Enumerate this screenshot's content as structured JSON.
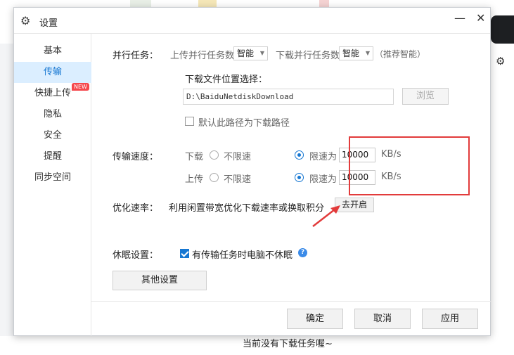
{
  "background": {
    "empty_message": "当前没有下载任务喔~"
  },
  "dialog": {
    "title": "设置",
    "title_icon": "gear-icon",
    "minimize_glyph": "—",
    "close_glyph": "✕"
  },
  "sidebar": {
    "items": [
      {
        "label": "基本"
      },
      {
        "label": "传输"
      },
      {
        "label": "快捷上传"
      },
      {
        "label": "隐私"
      },
      {
        "label": "安全"
      },
      {
        "label": "提醒"
      },
      {
        "label": "同步空间"
      }
    ],
    "active_index": 1,
    "new_badge": "NEW"
  },
  "parallel": {
    "section_label": "并行任务：",
    "upload_label": "上传并行任务数",
    "upload_value": "智能",
    "download_label": "下载并行任务数",
    "download_value": "智能",
    "hint": "（推荐智能）"
  },
  "download_location": {
    "label": "下载文件位置选择：",
    "path": "D:\\BaiduNetdiskDownload",
    "browse_button": "浏览",
    "default_checkbox_label": "默认此路径为下载路径",
    "default_checked": false
  },
  "speed": {
    "section_label": "传输速度：",
    "download_label": "下载",
    "upload_label": "上传",
    "unlimited_label": "不限速",
    "limit_label": "限速为",
    "download_limit": "10000",
    "upload_limit": "10000",
    "unit": "KB/s"
  },
  "optimize": {
    "section_label": "优化速率：",
    "description": "利用闲置带宽优化下载速率或换取积分",
    "button": "去开启"
  },
  "sleep": {
    "section_label": "休眠设置：",
    "checkbox_label": "有传输任务时电脑不休眠",
    "checked": true,
    "help_glyph": "?"
  },
  "other_button": "其他设置",
  "footer": {
    "ok": "确定",
    "cancel": "取消",
    "apply": "应用"
  },
  "colors": {
    "accent": "#1677d2",
    "active_bg": "#dbeeff",
    "highlight": "#e23b3b"
  }
}
